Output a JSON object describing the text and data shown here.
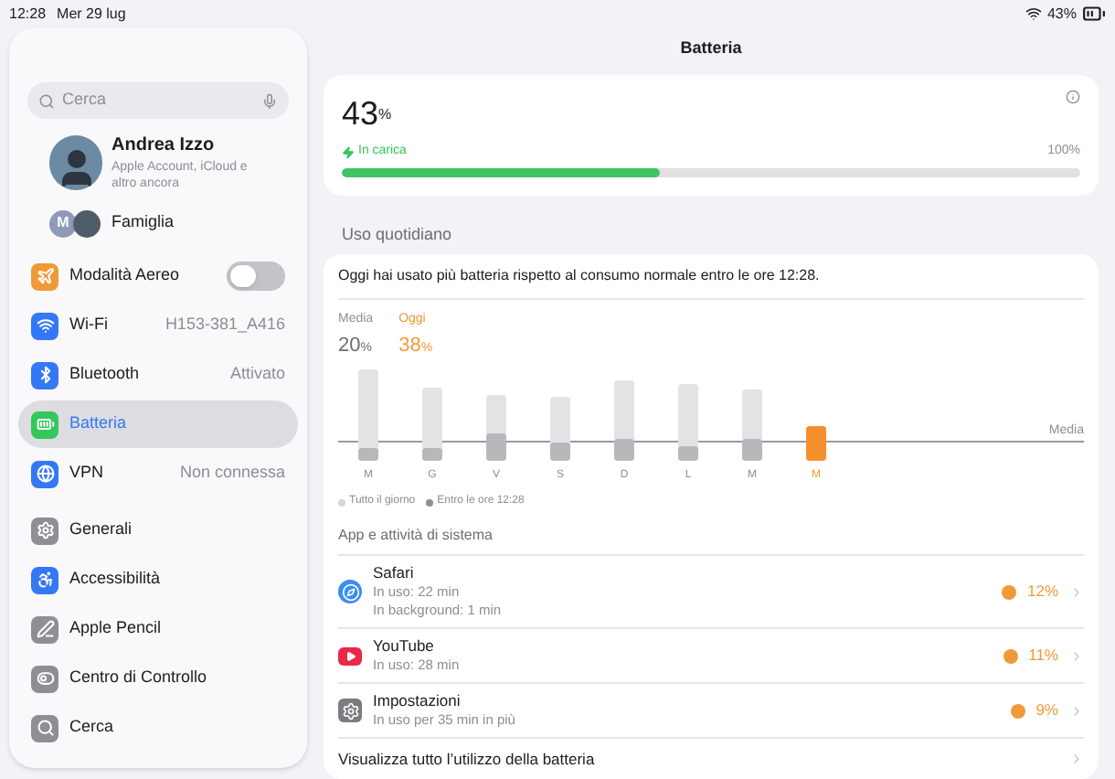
{
  "status_bar": {
    "time": "12:28",
    "date": "Mer 29 lug",
    "battery": "43%"
  },
  "sidebar": {
    "search": {
      "placeholder": "Cerca"
    },
    "account": {
      "name": "Andrea Izzo",
      "subtitle": "Apple Account, iCloud e altro ancora"
    },
    "family": {
      "initial": "M",
      "label": "Famiglia"
    },
    "groups": [
      [
        {
          "kind": "toggle",
          "label": "Modalità Aereo",
          "on": false,
          "selected": false
        },
        {
          "kind": "value",
          "label": "Wi-Fi",
          "value": "H153-381_A416",
          "selected": false
        },
        {
          "kind": "value",
          "label": "Bluetooth",
          "value": "Attivato",
          "selected": false
        },
        {
          "kind": "plain",
          "label": "Batteria",
          "selected": true
        },
        {
          "kind": "value",
          "label": "VPN",
          "value": "Non connessa",
          "selected": false
        }
      ],
      [
        {
          "kind": "plain",
          "label": "Generali",
          "selected": false
        },
        {
          "kind": "plain",
          "label": "Accessibilità",
          "selected": false
        },
        {
          "kind": "plain",
          "label": "Apple Pencil",
          "selected": false
        },
        {
          "kind": "plain",
          "label": "Centro di Controllo",
          "selected": false
        },
        {
          "kind": "plain",
          "label": "Cerca",
          "selected": false
        }
      ]
    ]
  },
  "main": {
    "title": "Batteria",
    "battery": {
      "percent": "43",
      "unit": "%",
      "status": "In carica",
      "max": "100%",
      "level": 0.43
    },
    "section": "Uso quotidiano",
    "usage": {
      "message": "Oggi hai usato più batteria rispetto al consumo normale entro le ore 12:28.",
      "average": {
        "label": "Media",
        "value": "20",
        "unit": "%"
      },
      "today": {
        "label": "Oggi",
        "value": "38",
        "unit": "%"
      },
      "median_label": "Media",
      "days": [
        {
          "label": "M",
          "selected": false
        },
        {
          "label": "G",
          "selected": false
        },
        {
          "label": "V",
          "selected": false
        },
        {
          "label": "S",
          "selected": false
        },
        {
          "label": "D",
          "selected": false
        },
        {
          "label": "L",
          "selected": false
        },
        {
          "label": "M",
          "selected": false
        },
        {
          "label": "M",
          "selected": true
        }
      ],
      "legend": [
        "Tutto il giorno",
        "Entro le ore 12:28"
      ]
    },
    "apps_header": "App e attività di sistema",
    "apps": [
      {
        "name": "Safari",
        "details": [
          "In uso: 22 min",
          "In background: 1 min"
        ],
        "percent": "12%"
      },
      {
        "name": "YouTube",
        "details": [
          "In uso: 28 min"
        ],
        "percent": "11%"
      },
      {
        "name": "Impostazioni",
        "details": [
          "In uso per 35 min in più"
        ],
        "percent": "9%"
      }
    ],
    "footer_link": "Visualizza tutto l’utilizzo della batteria"
  }
}
